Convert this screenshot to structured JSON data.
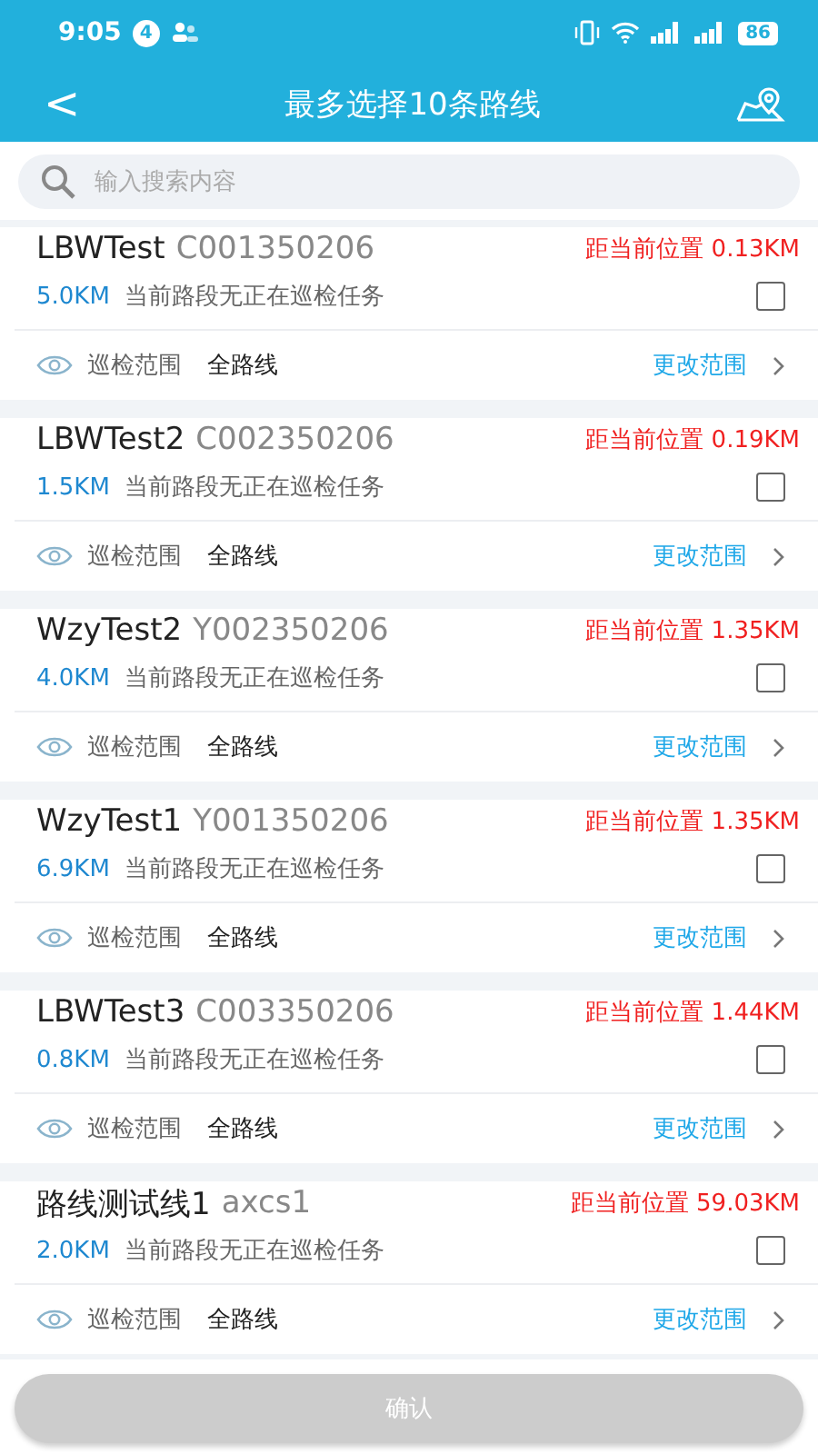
{
  "status_bar": {
    "time": "9:05",
    "notification_count": "4",
    "battery": "86"
  },
  "header": {
    "back": "<",
    "title": "最多选择10条路线"
  },
  "search": {
    "placeholder": "输入搜索内容"
  },
  "routes": [
    {
      "name": "LBWTest",
      "code": "C001350206",
      "distance": "距当前位置 0.13KM",
      "length": "5.0KM",
      "task_status": "当前路段无正在巡检任务",
      "checked": false,
      "range_label": "巡检范围",
      "range_value": "全路线",
      "action": "更改范围"
    },
    {
      "name": "LBWTest2",
      "code": "C002350206",
      "distance": "距当前位置 0.19KM",
      "length": "1.5KM",
      "task_status": "当前路段无正在巡检任务",
      "checked": false,
      "range_label": "巡检范围",
      "range_value": "全路线",
      "action": "更改范围"
    },
    {
      "name": "WzyTest2",
      "code": "Y002350206",
      "distance": "距当前位置 1.35KM",
      "length": "4.0KM",
      "task_status": "当前路段无正在巡检任务",
      "checked": false,
      "range_label": "巡检范围",
      "range_value": "全路线",
      "action": "更改范围"
    },
    {
      "name": "WzyTest1",
      "code": "Y001350206",
      "distance": "距当前位置 1.35KM",
      "length": "6.9KM",
      "task_status": "当前路段无正在巡检任务",
      "checked": false,
      "range_label": "巡检范围",
      "range_value": "全路线",
      "action": "更改范围"
    },
    {
      "name": "LBWTest3",
      "code": "C003350206",
      "distance": "距当前位置 1.44KM",
      "length": "0.8KM",
      "task_status": "当前路段无正在巡检任务",
      "checked": false,
      "range_label": "巡检范围",
      "range_value": "全路线",
      "action": "更改范围"
    },
    {
      "name": "路线测试线1",
      "code": "axcs1",
      "distance": "距当前位置 59.03KM",
      "length": "2.0KM",
      "task_status": "当前路段无正在巡检任务",
      "checked": false,
      "range_label": "巡检范围",
      "range_value": "全路线",
      "action": "更改范围"
    }
  ],
  "confirm_button": {
    "label": "确认",
    "disabled": true
  }
}
